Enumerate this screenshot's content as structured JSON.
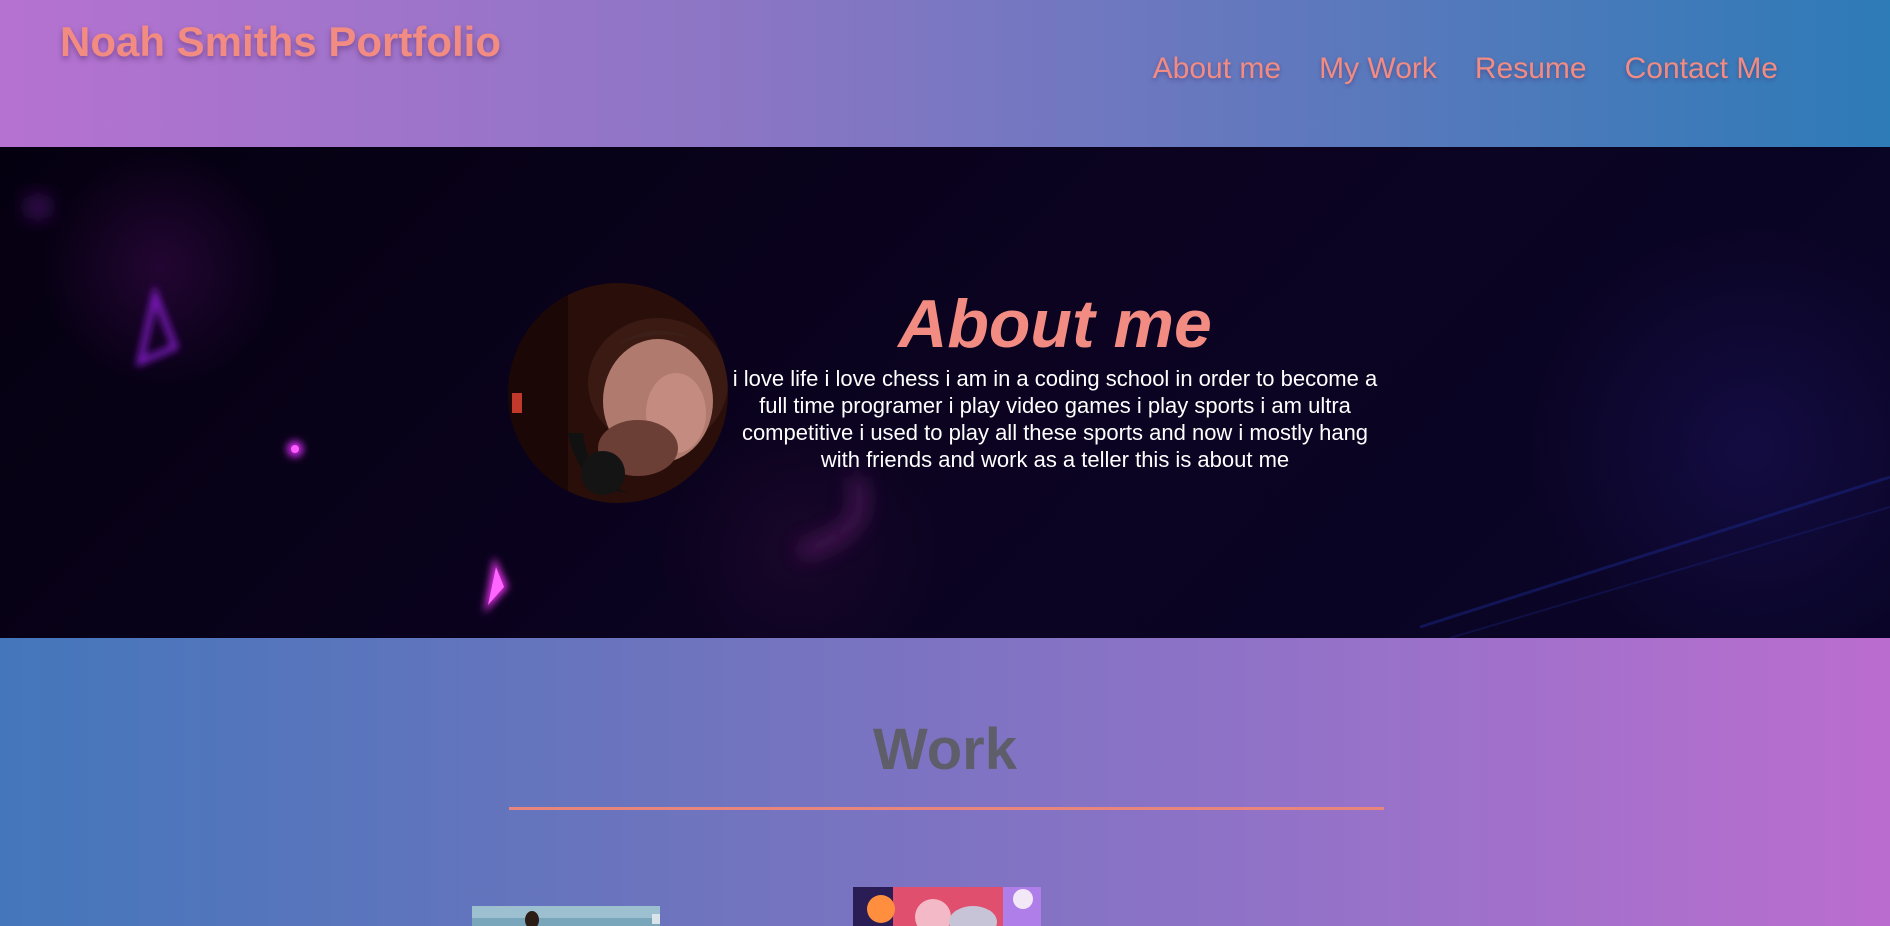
{
  "header": {
    "title": "Noah Smiths Portfolio",
    "nav": [
      {
        "label": "About me"
      },
      {
        "label": "My Work"
      },
      {
        "label": "Resume"
      },
      {
        "label": "Contact Me"
      }
    ]
  },
  "about": {
    "title": "About me",
    "text": "i love life i love chess i am in a coding school in order to become a full time programer i play video games i play sports i am ultra competitive i used to play all these sports and now i mostly hang with friends and work as a teller this is about me"
  },
  "work": {
    "title": "Work"
  },
  "colors": {
    "accent": "#f28b82",
    "header_gradient": [
      "#b672d1",
      "#2d7bb7"
    ],
    "work_gradient": [
      "#4476bb",
      "#bb6dcf"
    ],
    "hero_background": "#070012",
    "work_title": "#5e5e6a"
  },
  "icons": {
    "hero_background": "neon-triangles-image",
    "avatar": "profile-photo",
    "work_thumbnails": [
      "project-thumbnail-person",
      "project-thumbnail-game-art"
    ]
  }
}
